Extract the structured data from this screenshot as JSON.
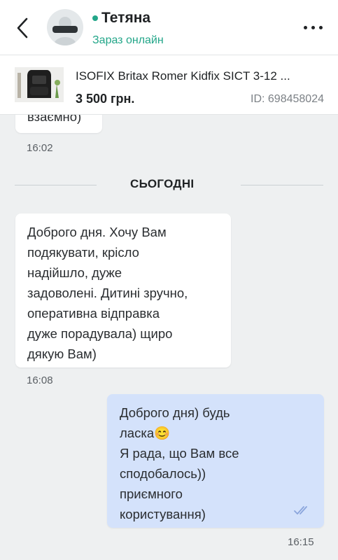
{
  "header": {
    "contact_name": "Тетяна",
    "status": "Зараз онлайн"
  },
  "listing": {
    "title": "ISOFIX Britax Romer Kidfix SICT 3-12 ...",
    "price": "3 500 грн.",
    "id_label": "ID: 698458024"
  },
  "chat": {
    "previous": {
      "partial_text": "взаємно)",
      "time": "16:02"
    },
    "divider": "СЬОГОДНІ",
    "messages": [
      {
        "direction": "in",
        "text": "Доброго дня.  Хочу Вам\nподякувати, крісло\nнадійшло, дуже\nзадоволені. Дитині зручно,\nоперативна відправка\nдуже порадувала) щиро\nдякую Вам)",
        "time": "16:08"
      },
      {
        "direction": "out",
        "text_line1": "Доброго дня) будь",
        "text_line2": "ласка",
        "emoji": "😊",
        "text_rest": "Я рада, що Вам все\nсподобалось))\nприємного\nкористування)",
        "time": "16:15",
        "read_icon": "double-check-icon"
      }
    ]
  },
  "colors": {
    "online": "#23a689",
    "outgoing_bubble": "#d4e2fb",
    "incoming_bubble": "#ffffff",
    "background": "#eef0f1"
  }
}
